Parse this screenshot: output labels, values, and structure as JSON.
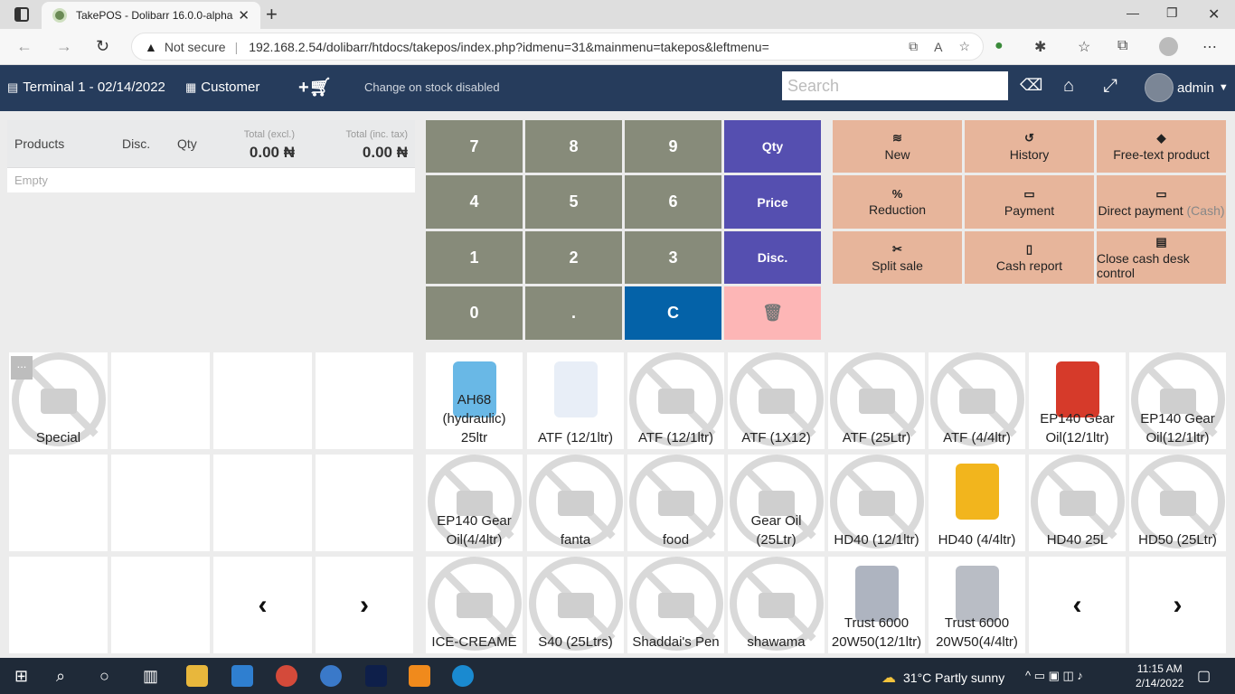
{
  "browser": {
    "tab_title": "TakePOS - Dolibarr 16.0.0-alpha",
    "tab_close": "✕",
    "new_tab": "+",
    "not_secure": "Not secure",
    "url": "192.168.2.54/dolibarr/htdocs/takepos/index.php?idmenu=31&mainmenu=takepos&leftmenu="
  },
  "header": {
    "terminal": "Terminal 1 - 02/14/2022",
    "customer": "Customer",
    "stock_msg": "Change on stock disabled",
    "search_placeholder": "Search",
    "user": "admin"
  },
  "order": {
    "col_products": "Products",
    "col_disc": "Disc.",
    "col_qty": "Qty",
    "col_total_excl": "Total (excl.)",
    "col_total_inc": "Total (inc. tax)",
    "total_excl_value": "0.00 ₦",
    "total_inc_value": "0.00 ₦",
    "empty": "Empty"
  },
  "keypad": {
    "k7": "7",
    "k8": "8",
    "k9": "9",
    "k4": "4",
    "k5": "5",
    "k6": "6",
    "k1": "1",
    "k2": "2",
    "k3": "3",
    "k0": "0",
    "kdot": ".",
    "kc": "C",
    "qty": "Qty",
    "price": "Price",
    "disc": "Disc."
  },
  "actions": {
    "new": "New",
    "history": "History",
    "free_text": "Free-text product",
    "reduction": "Reduction",
    "payment": "Payment",
    "direct_payment": "Direct payment",
    "direct_payment_suffix": "(Cash)",
    "split_sale": "Split sale",
    "cash_report": "Cash report",
    "close_cash": "Close cash desk control"
  },
  "categories": {
    "ellipsis": "...",
    "items": [
      "Special"
    ]
  },
  "products": [
    {
      "name": "AH68 (hydraulic) 25ltr",
      "image": "blue-jerrycan"
    },
    {
      "name": "ATF (12/1ltr)",
      "image": "trust-atf-bottle"
    },
    {
      "name": "ATF (12/1ltr)",
      "image": "no-image"
    },
    {
      "name": "ATF (1X12)",
      "image": "no-image"
    },
    {
      "name": "ATF (25Ltr)",
      "image": "no-image"
    },
    {
      "name": "ATF (4/4ltr)",
      "image": "no-image"
    },
    {
      "name": "EP140 Gear Oil(12/1ltr)",
      "image": "red-bottle"
    },
    {
      "name": "EP140 Gear Oil(12/1ltr)",
      "image": "no-image"
    },
    {
      "name": "EP140 Gear Oil(4/4ltr)",
      "image": "no-image"
    },
    {
      "name": "fanta",
      "image": "no-image"
    },
    {
      "name": "food",
      "image": "no-image"
    },
    {
      "name": "Gear Oil (25Ltr)",
      "image": "no-image"
    },
    {
      "name": "HD40 (12/1ltr)",
      "image": "no-image"
    },
    {
      "name": "HD40 (4/4ltr)",
      "image": "yellow-trust-can"
    },
    {
      "name": "HD40 25L",
      "image": "no-image"
    },
    {
      "name": "HD50 (25Ltr)",
      "image": "no-image"
    },
    {
      "name": "ICE-CREAME",
      "image": "no-image"
    },
    {
      "name": "S40 (25Ltrs)",
      "image": "no-image"
    },
    {
      "name": "Shaddai's Pen",
      "image": "no-image"
    },
    {
      "name": "shawama",
      "image": "no-image"
    },
    {
      "name": "Trust 6000 20W50(12/1ltr)",
      "image": "grey-bottle"
    },
    {
      "name": "Trust 6000 20W50(4/4ltr)",
      "image": "grey-can"
    }
  ],
  "taskbar": {
    "weather": "31°C  Partly sunny",
    "time": "11:15 AM",
    "date": "2/14/2022"
  },
  "colors": {
    "header_bg": "#263c5c",
    "num_key": "#878b7a",
    "action_key": "#554fb0",
    "clear_key": "#0462a8",
    "delete_key": "#fdb6b6",
    "function_btn": "#e7b59b"
  }
}
